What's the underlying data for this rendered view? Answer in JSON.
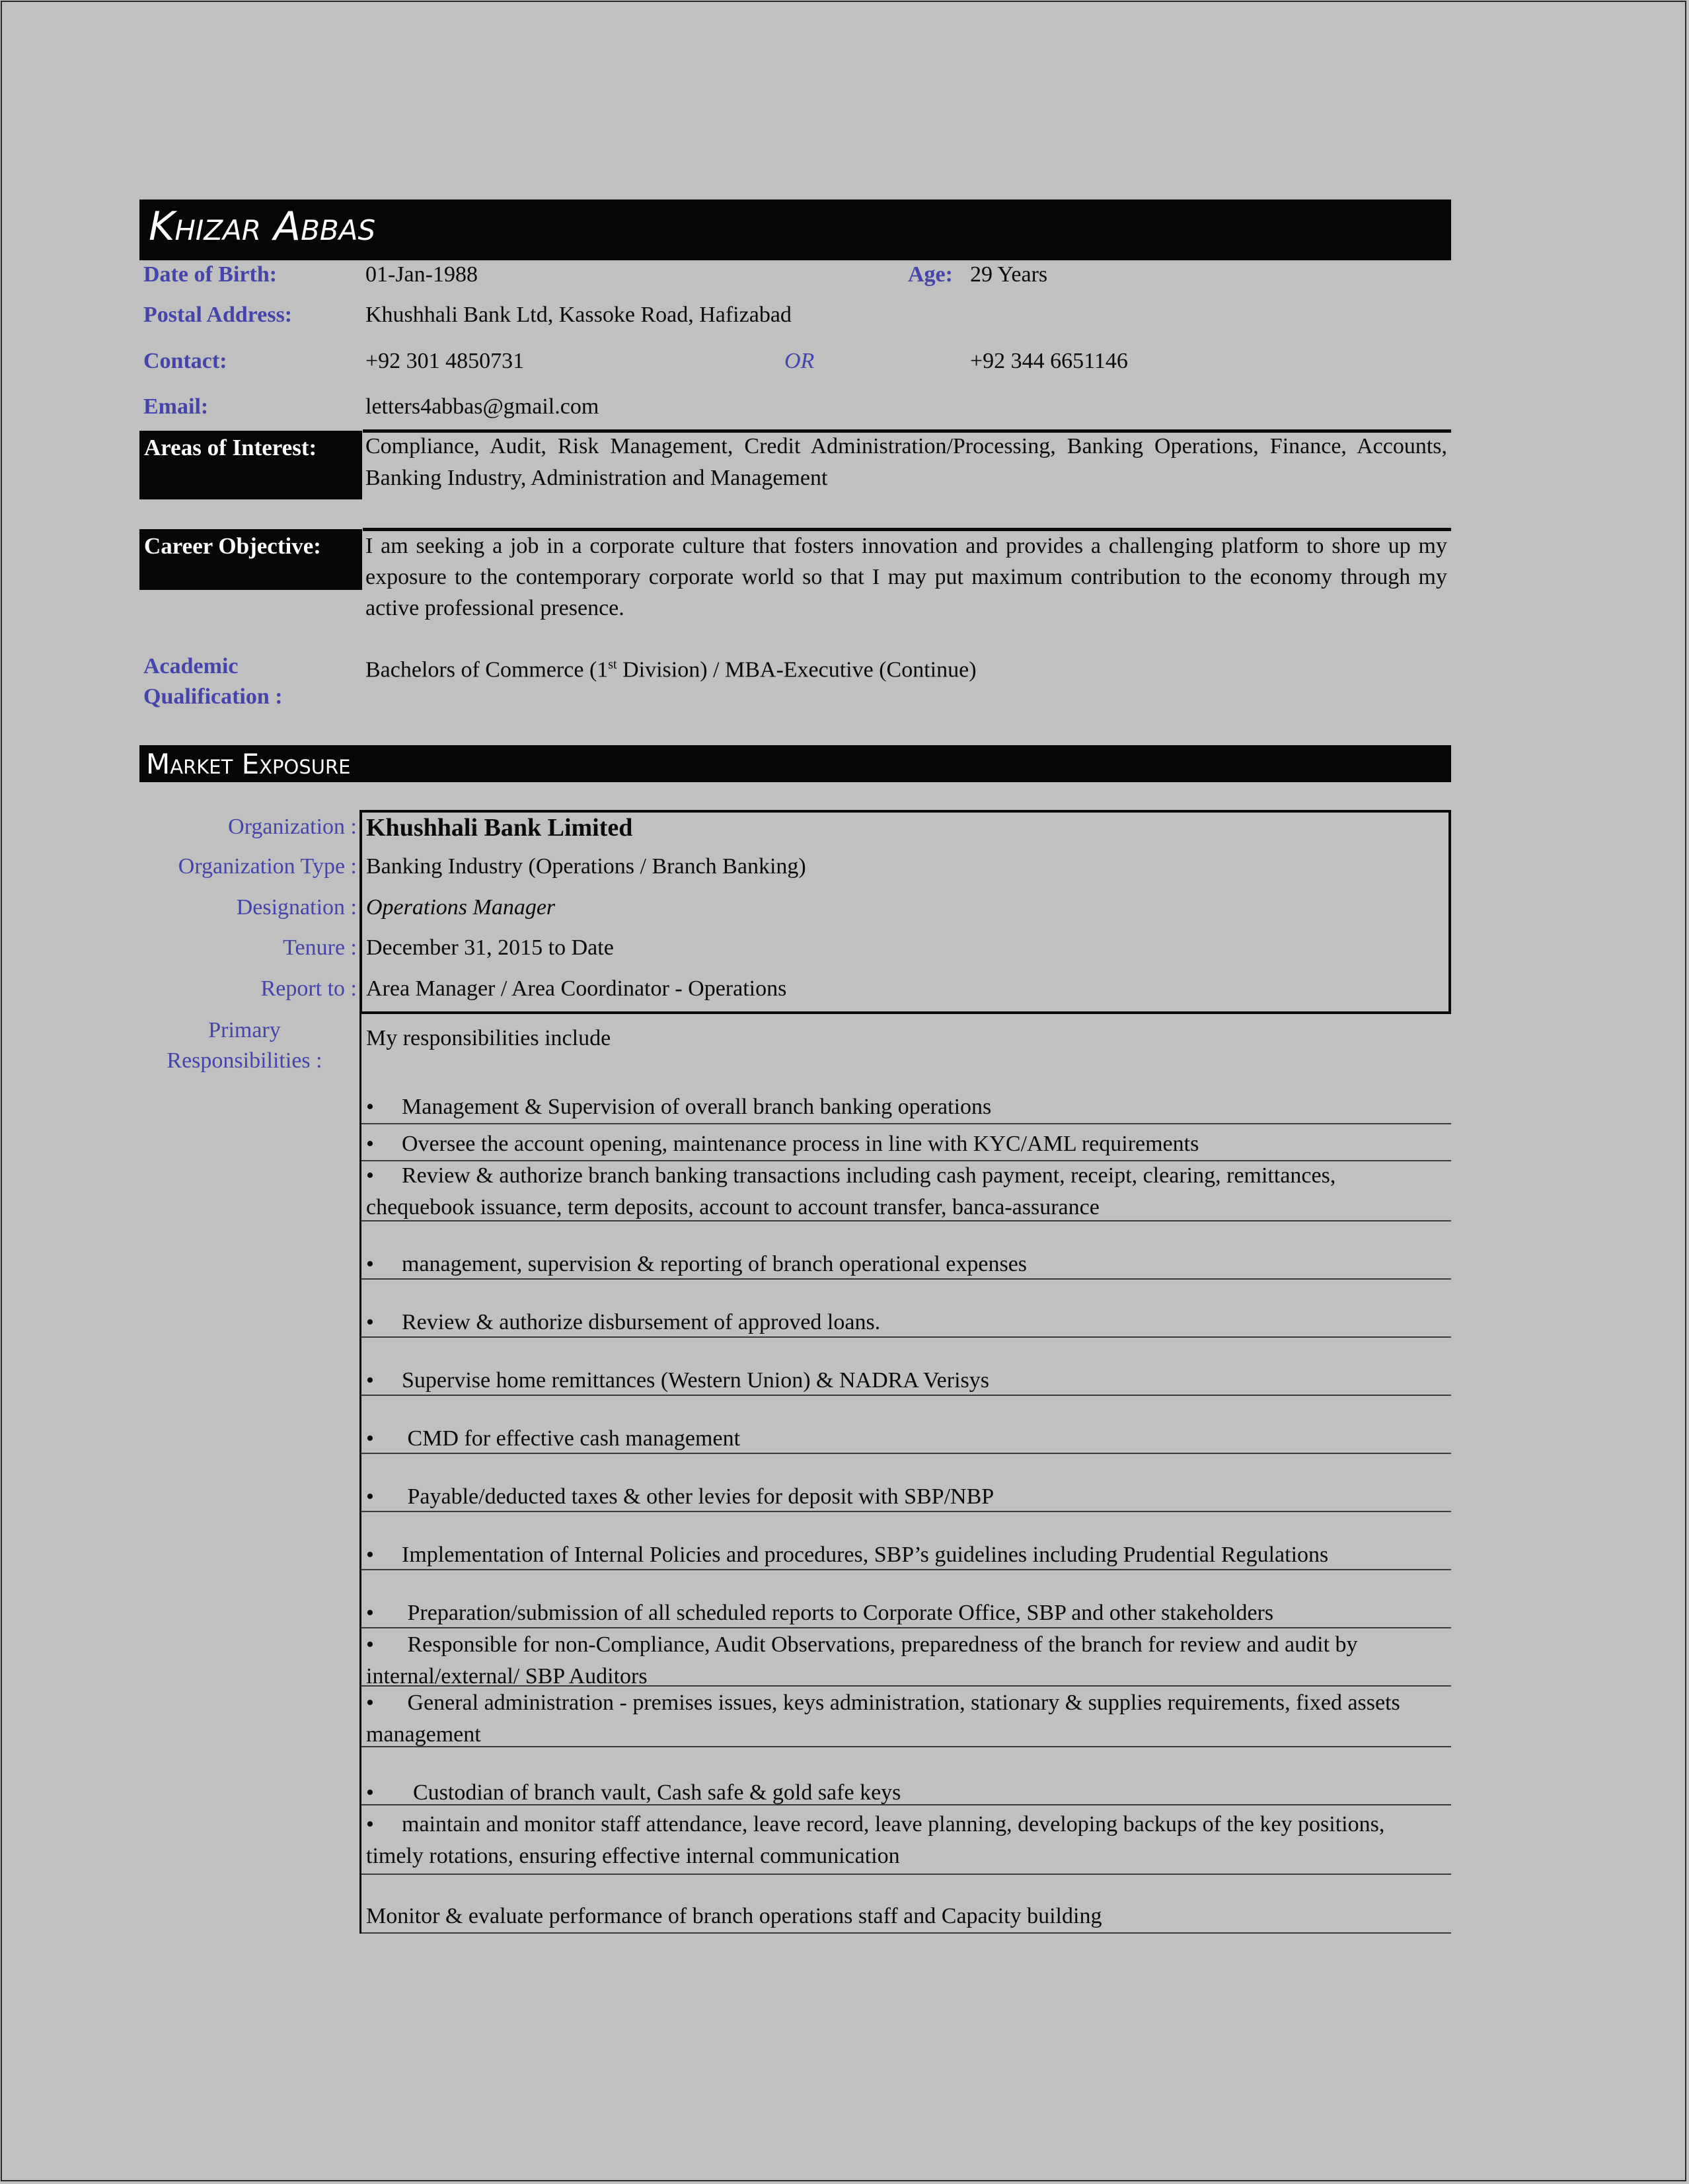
{
  "header": {
    "name": "Khizar Abbas"
  },
  "personal": {
    "dob_label": "Date of Birth:",
    "dob": "01-Jan-1988",
    "age_label": "Age:",
    "age": "29 Years",
    "address_label": "Postal Address:",
    "address": "Khushhali Bank Ltd, Kassoke Road, Hafizabad",
    "contact_label": "Contact:",
    "phone_primary": "+92 301 4850731",
    "or_label": "OR",
    "phone_secondary": "+92 344 6651146",
    "email_label": "Email:",
    "email": "letters4abbas@gmail.com"
  },
  "interests": {
    "label": "Areas of Interest:",
    "text": "Compliance, Audit, Risk Management, Credit Administration/Processing, Banking Operations, Finance, Accounts, Banking Industry, Administration and Management"
  },
  "objective": {
    "label": "Career Objective:",
    "text": "I am seeking a job in a corporate culture that fosters innovation and provides a challenging platform to shore up my exposure to the contemporary corporate world so that I may put maximum contribution to the economy through my active professional presence."
  },
  "academic": {
    "label_line1": "Academic",
    "label_line2": "Qualification :",
    "text_before": "Bachelors of Commerce (1",
    "superscript": "st",
    "text_after": " Division) / MBA-Executive (Continue)"
  },
  "market_exposure": {
    "title": "Market Exposure",
    "organization_label": "Organization :",
    "organization": "Khushhali Bank Limited",
    "org_type_label": "Organization Type :",
    "org_type": "Banking Industry (Operations / Branch Banking)",
    "designation_label": "Designation :",
    "designation": "Operations Manager",
    "tenure_label": "Tenure :",
    "tenure": "December 31, 2015 to Date",
    "report_label": "Report to :",
    "report_to": "Area Manager / Area Coordinator - Operations",
    "responsibilities_label_line1": "Primary",
    "responsibilities_label_line2": "Responsibilities :",
    "responsibilities_intro": "My responsibilities  include",
    "bullet_glyph": "•",
    "responsibilities": [
      "Management & Supervision of overall branch banking operations",
      "Oversee the account opening, maintenance process in line with KYC/AML requirements",
      "Review & authorize branch banking transactions including cash payment, receipt, clearing, remittances, chequebook issuance, term deposits, account to account transfer, banca-assurance",
      "management, supervision & reporting of branch operational expenses",
      "Review & authorize disbursement of approved loans.",
      "Supervise home remittances (Western Union) & NADRA Verisys",
      " CMD for effective cash management",
      " Payable/deducted taxes & other levies for deposit with SBP/NBP",
      "Implementation of Internal Policies and procedures, SBP’s guidelines including Prudential Regulations",
      " Preparation/submission of all scheduled reports to Corporate Office, SBP and other stakeholders",
      " Responsible for non-Compliance, Audit Observations, preparedness of the branch for review and audit by internal/external/ SBP Auditors",
      " General administration - premises issues, keys administration, stationary & supplies requirements, fixed assets management",
      "  Custodian of branch vault, Cash safe & gold safe keys",
      "maintain and monitor staff attendance, leave record, leave planning, developing backups of the key positions, timely rotations, ensuring effective internal communication"
    ],
    "closing_item": "Monitor & evaluate performance of branch operations staff  and Capacity building"
  }
}
